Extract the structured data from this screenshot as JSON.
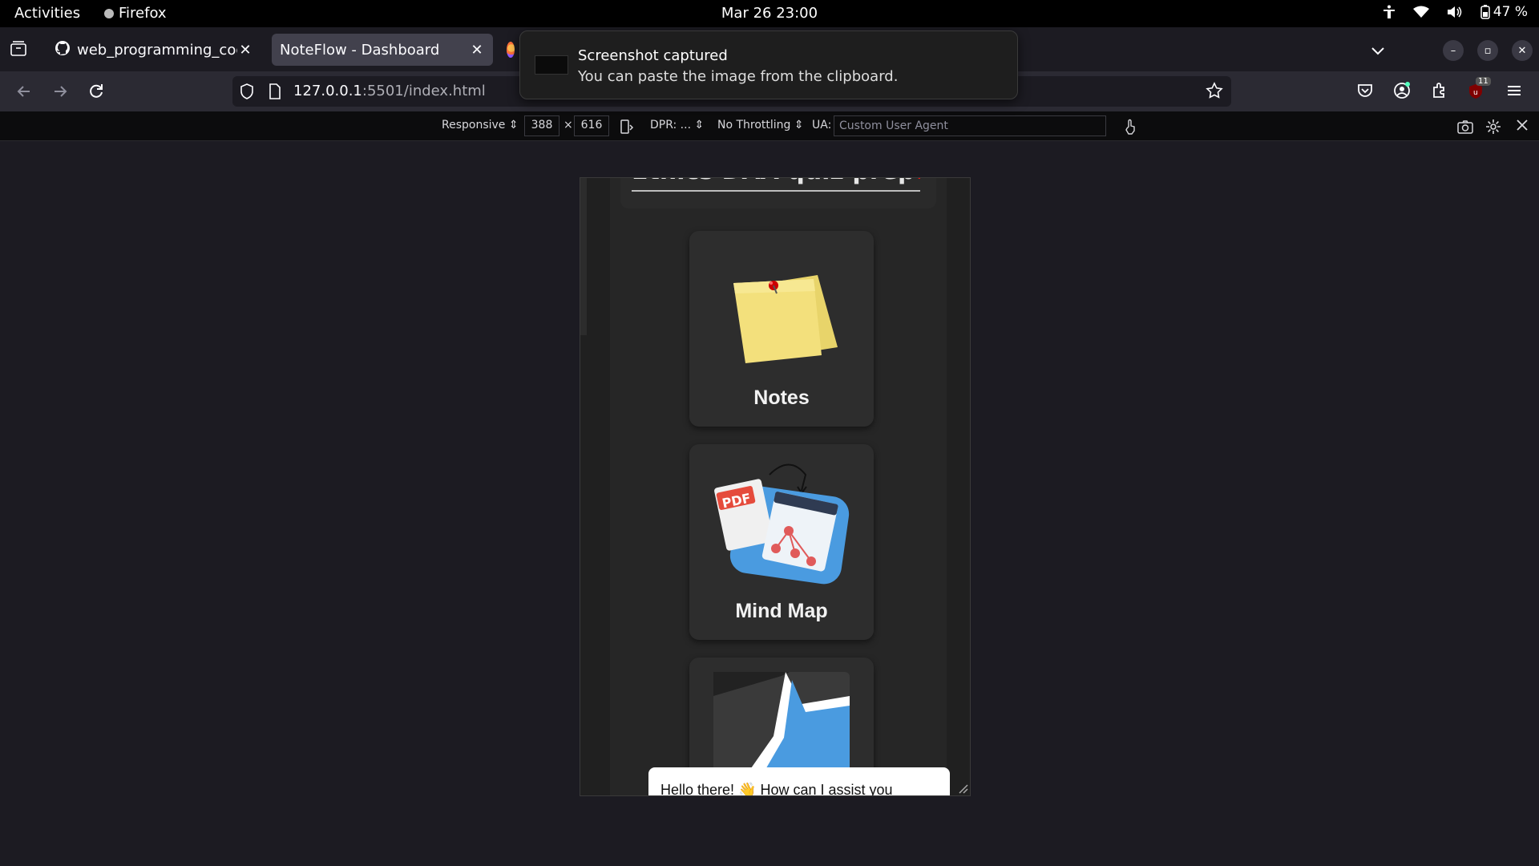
{
  "system_bar": {
    "activities": "Activities",
    "app_name": "Firefox",
    "clock": "Mar 26  23:00",
    "battery": "47 %"
  },
  "tabs": [
    {
      "title": "web_programming_code",
      "icon": "github-icon"
    },
    {
      "title": "NoteFlow - Dashboard",
      "icon": "none"
    },
    {
      "title": "",
      "icon": "firefox-icon"
    }
  ],
  "notification": {
    "title": "Screenshot captured",
    "body": "You can paste the image from the clipboard."
  },
  "urlbar": {
    "host": "127.0.0.1",
    "rest": ":5501/index.html"
  },
  "extension_badge": "11",
  "rdm": {
    "device": "Responsive",
    "width": "388",
    "times": "×",
    "height": "616",
    "dpr": "DPR: ...",
    "throttling": "No Throttling",
    "ua_label": "UA:",
    "ua_placeholder": "Custom User Agent"
  },
  "page": {
    "heading_visible": "Ethics DAA quiz prep",
    "heading_suffix": "!",
    "cards": [
      {
        "label": "Notes",
        "icon": "sticky-notes-icon"
      },
      {
        "label": "Mind Map",
        "icon": "mind-map-icon"
      },
      {
        "label": "",
        "icon": "star-app-icon"
      }
    ],
    "chat_message": "Hello there! 👋 How can I assist you"
  },
  "colors": {
    "accent_red": "#ee1111",
    "sticky_yellow": "#f3e07c",
    "mindmap_blue": "#4a9be0"
  }
}
